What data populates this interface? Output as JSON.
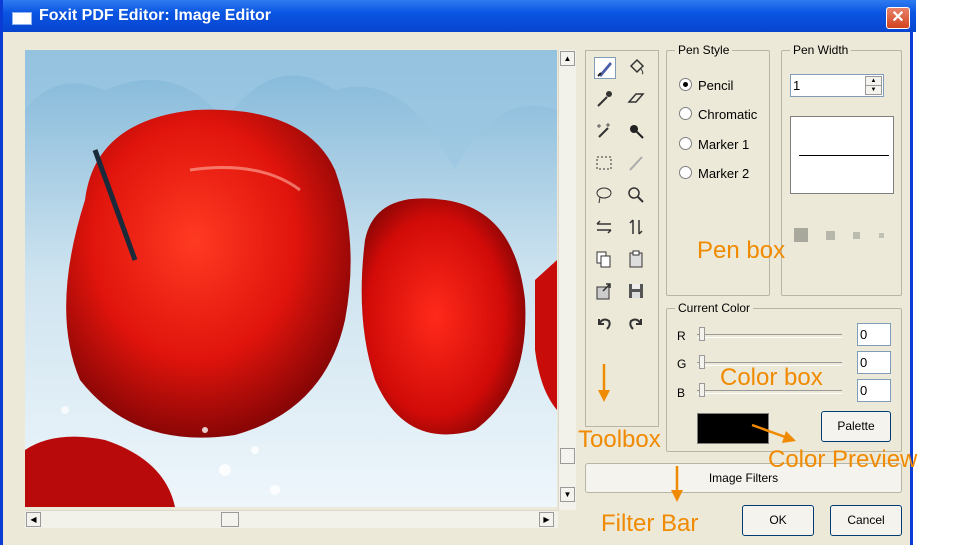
{
  "window": {
    "title": "Foxit PDF Editor: Image Editor",
    "close_glyph": "✕"
  },
  "pen_style": {
    "legend": "Pen Style",
    "options": [
      {
        "label": "Pencil",
        "selected": true
      },
      {
        "label": "Chromatic",
        "selected": false
      },
      {
        "label": "Marker 1",
        "selected": false
      },
      {
        "label": "Marker 2",
        "selected": false
      }
    ]
  },
  "pen_width": {
    "legend": "Pen Width",
    "value": "1"
  },
  "current_color": {
    "legend": "Current Color",
    "r_label": "R",
    "g_label": "G",
    "b_label": "B",
    "r_value": "0",
    "g_value": "0",
    "b_value": "0",
    "preview_color": "#000000",
    "palette_label": "Palette"
  },
  "buttons": {
    "image_filters": "Image Filters",
    "ok": "OK",
    "cancel": "Cancel"
  },
  "annotations": {
    "pen_box": "Pen box",
    "color_box": "Color box",
    "toolbox": "Toolbox",
    "color_preview": "Color Preview",
    "filter_bar": "Filter Bar"
  },
  "colors": {
    "annotation": "#f08a00",
    "titlebar": "#0a55e2",
    "dialog_bg": "#ece9d8"
  }
}
